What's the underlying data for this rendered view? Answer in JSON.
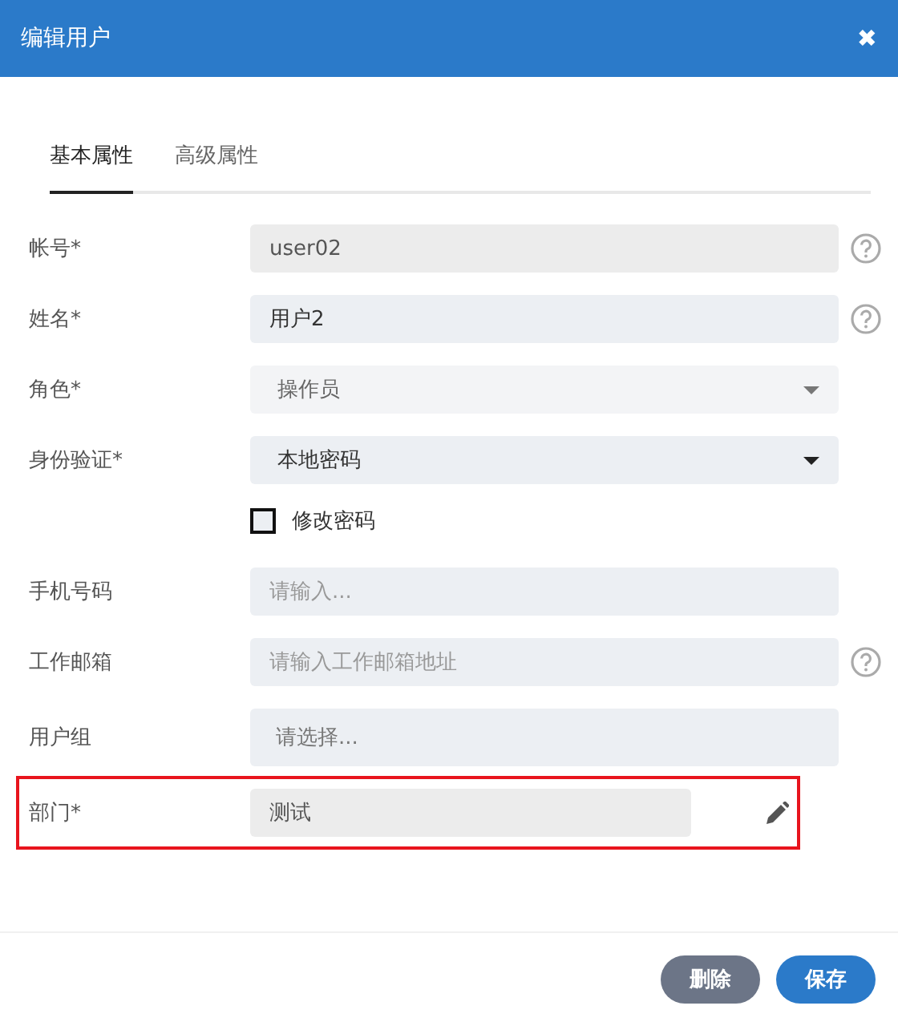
{
  "dialog": {
    "title": "编辑用户",
    "close": "✖"
  },
  "tabs": [
    {
      "label": "基本属性",
      "selected": true
    },
    {
      "label": "高级属性",
      "selected": false
    }
  ],
  "fields": [
    {
      "kind": "text",
      "label": "帐号*",
      "value": "user02",
      "disabled": true,
      "help": true
    },
    {
      "kind": "text",
      "label": "姓名*",
      "value": "用户2",
      "disabled": false,
      "help": true
    },
    {
      "kind": "select",
      "label": "角色*",
      "value": "操作员",
      "disabled": true
    },
    {
      "kind": "select",
      "label": "身份验证*",
      "value": "本地密码",
      "disabled": false
    },
    {
      "kind": "checkbox",
      "label": "修改密码",
      "checked": false
    },
    {
      "kind": "text",
      "label": "手机号码",
      "placeholder": "请输入..."
    },
    {
      "kind": "text",
      "label": "工作邮箱",
      "placeholder": "请输入工作邮箱地址",
      "help": true
    },
    {
      "kind": "picker",
      "label": "用户组",
      "placeholder": "请选择..."
    },
    {
      "kind": "edit",
      "label": "部门*",
      "value": "测试",
      "highlighted": true
    }
  ],
  "buttons": [
    {
      "kind": "danger",
      "label": "删除"
    },
    {
      "kind": "primary",
      "label": "保存"
    }
  ]
}
